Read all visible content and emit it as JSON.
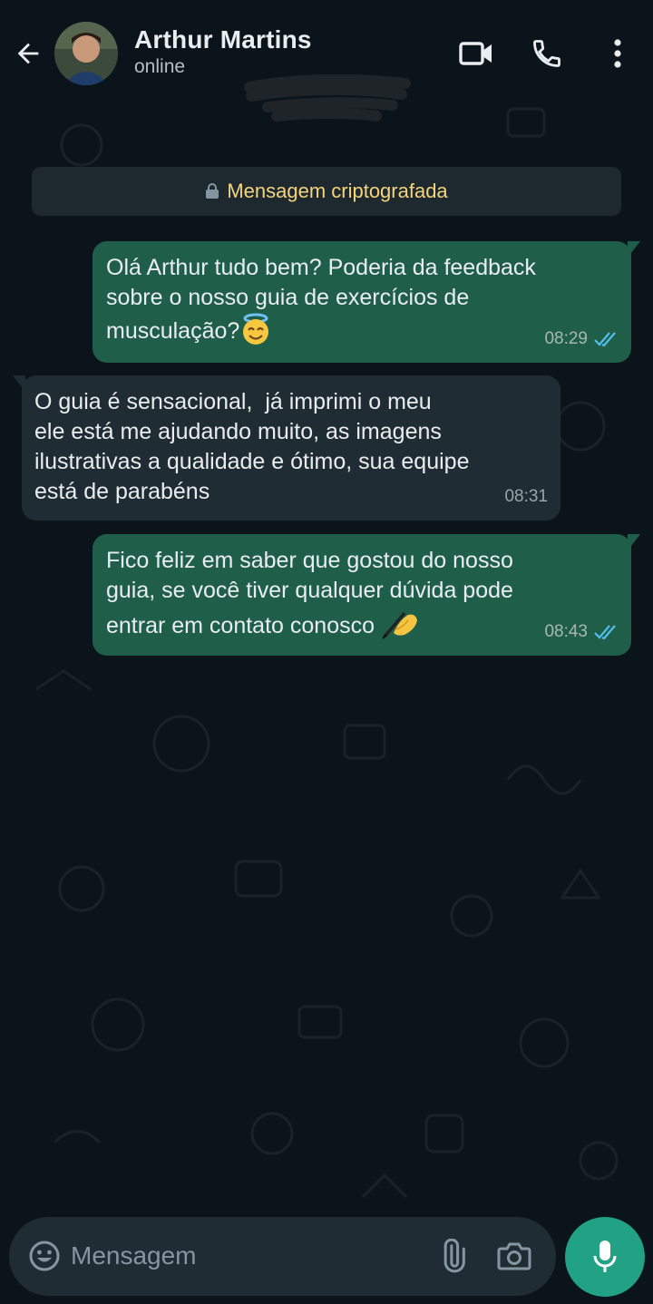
{
  "header": {
    "contact_name": "Arthur Martins",
    "status": "online",
    "icons": [
      "back-arrow-icon",
      "video-call-icon",
      "phone-call-icon",
      "more-options-icon"
    ]
  },
  "encryption_notice": {
    "text": "Mensagem criptografada",
    "icon": "lock-icon",
    "color": "#f4d47c"
  },
  "messages": [
    {
      "direction": "outgoing",
      "lines": [
        "Olá Arthur tudo bem? Poderia da feedback",
        "sobre o nosso guia de exercícios de",
        "musculação?"
      ],
      "emoji": "😇",
      "time": "08:29",
      "read": true
    },
    {
      "direction": "incoming",
      "lines": [
        "O guia é sensacional,  já imprimi o meu",
        "ele está me ajudando muito, as imagens",
        "ilustrativas a qualidade e ótimo, sua equipe",
        "está de parabéns"
      ],
      "time": "08:31"
    },
    {
      "direction": "outgoing",
      "lines": [
        "Fico feliz em saber que gostou do nosso",
        "guia, se você tiver qualquer dúvida pode",
        "entrar em contato conosco "
      ],
      "emoji": "✍",
      "time": "08:43",
      "read": true
    }
  ],
  "composer": {
    "placeholder": "Mensagem",
    "icons": [
      "emoji-icon",
      "attach-icon",
      "camera-icon",
      "mic-icon"
    ]
  },
  "colors": {
    "background": "#0b141a",
    "outgoing_bubble": "#1f5f4a",
    "incoming_bubble": "#202c33",
    "read_ticks": "#53bdeb",
    "accent": "#21a285"
  }
}
